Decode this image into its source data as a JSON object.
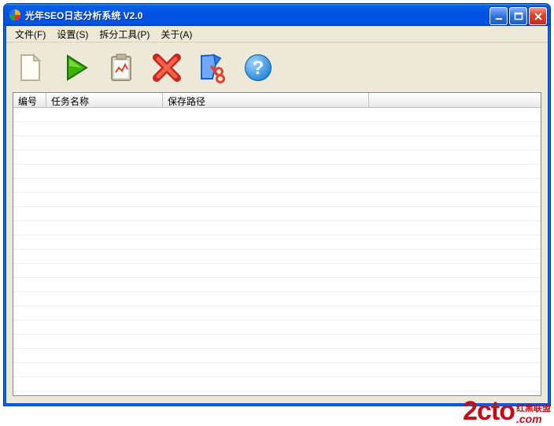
{
  "title": "光年SEO日志分析系统 V2.0",
  "menubar": [
    {
      "label": "文件(F)"
    },
    {
      "label": "设置(S)"
    },
    {
      "label": "拆分工具(P)"
    },
    {
      "label": "关于(A)"
    }
  ],
  "toolbar": [
    {
      "name": "new-document"
    },
    {
      "name": "run-play"
    },
    {
      "name": "report-clipboard"
    },
    {
      "name": "delete-cancel"
    },
    {
      "name": "cut-tool"
    },
    {
      "name": "help-about"
    }
  ],
  "columns": {
    "c1": "编号",
    "c2": "任务名称",
    "c3": "保存路径",
    "c4": ""
  },
  "watermark": {
    "main": "2cto",
    "cn": "红黑联盟",
    "com": ".com"
  }
}
